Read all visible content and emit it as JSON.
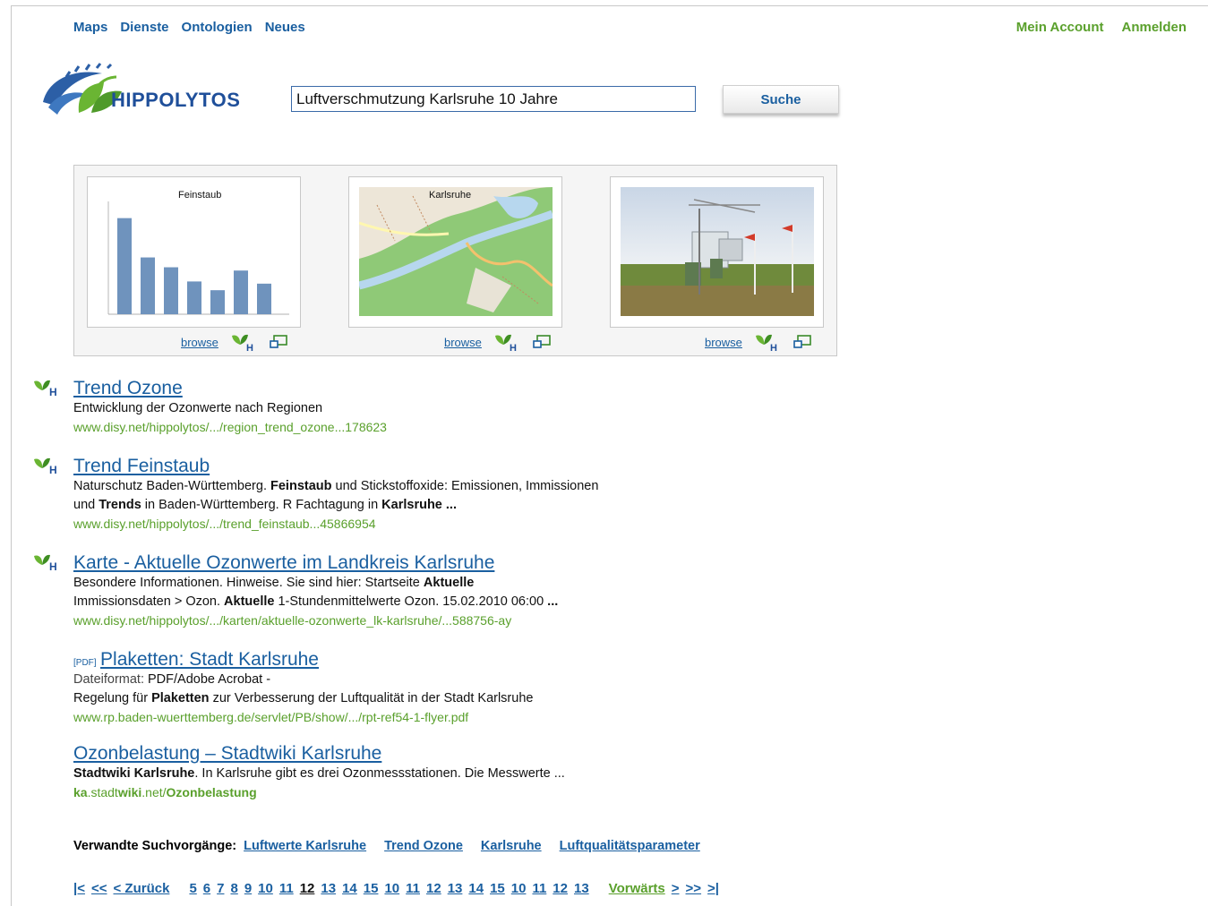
{
  "nav": {
    "items": [
      "Maps",
      "Dienste",
      "Ontologien",
      "Neues"
    ],
    "account": "Mein Account",
    "login": "Anmelden"
  },
  "logo": {
    "text": "HIPPOLYTOS"
  },
  "search": {
    "value": "Luftverschmutzung Karlsruhe 10 Jahre",
    "button": "Suche"
  },
  "previews": [
    {
      "label": "Feinstaub",
      "browse": "browse",
      "type": "chart"
    },
    {
      "label": "Karlsruhe",
      "browse": "browse",
      "type": "map"
    },
    {
      "label": "",
      "browse": "browse",
      "type": "photo"
    }
  ],
  "results": [
    {
      "title": "Trend Ozone",
      "snippet_html": "Entwicklung der Ozonwerte nach Regionen",
      "url": "www.disy.net/hippolytos/.../region_trend_ozone...178623",
      "icon": "hippolytos-icon"
    },
    {
      "title": "Trend Feinstaub",
      "snippet_html": "Naturschutz Baden-Württemberg. <b>Feinstaub</b> und Stickstoffoxide: Emissionen, Immissionen<br>und <b>Trends</b> in Baden-Württemberg. R Fachtagung in <b>Karlsruhe ...</b>",
      "url": "www.disy.net/hippolytos/.../trend_feinstaub...45866954",
      "icon": "hippolytos-icon"
    },
    {
      "title": "Karte - Aktuelle Ozonwerte im Landkreis Karlsruhe",
      "snippet_html": "Besondere Informationen. Hinweise. Sie sind hier: Startseite <b>Aktuelle</b><br>Immissionsdaten &gt; Ozon. <b>Aktuelle</b> 1-Stundenmittelwerte Ozon. 15.02.2010 06:00 <b>...</b>",
      "url": "www.disy.net/hippolytos/.../karten/aktuelle-ozonwerte_lk-karlsruhe/...588756-ay",
      "icon": "hippolytos-icon"
    },
    {
      "title": "Plaketten: Stadt Karlsruhe",
      "pdf": "[PDF]",
      "snippet_html": "<span style='color:#444'>Dateiformat:</span> PDF/Adobe Acrobat -<br>Regelung für <b>Plaketten</b> zur Verbesserung der Luftqualität in der Stadt Karlsruhe",
      "url": "www.rp.baden-wuerttemberg.de/servlet/PB/show/.../rpt-ref54-1-flyer.pdf"
    },
    {
      "title": "Ozonbelastung – Stadtwiki Karlsruhe",
      "snippet_html": "<b>Stadtwiki Karlsruhe</b>. In Karlsruhe gibt es drei Ozonmessstationen. Die Messwerte ...",
      "url_html": "<b>ka</b>.stadt<b>wiki</b>.net/<b>Ozonbelastung</b>"
    }
  ],
  "related": {
    "label": "Verwandte Suchvorgänge:",
    "links": [
      "Luftwerte Karlsruhe",
      "Trend Ozone",
      "Karlsruhe",
      "Luftqualitätsparameter"
    ]
  },
  "pager": {
    "first": "|<",
    "prev2": "<<",
    "prev": "< Zurück",
    "pages": [
      "5",
      "6",
      "7",
      "8",
      "9",
      "10",
      "11",
      "12",
      "13",
      "14",
      "15",
      "10",
      "11",
      "12",
      "13",
      "14",
      "15",
      "10",
      "11",
      "12",
      "13"
    ],
    "current_index": 7,
    "next": "Vorwärts",
    "next1": ">",
    "next2": ">>",
    "last": ">|"
  },
  "chart_values": [
    88,
    52,
    43,
    30,
    22,
    40,
    28
  ],
  "colors": {
    "link_blue": "#1a5fa0",
    "green": "#5aa02c",
    "bar": "#6f93bd"
  }
}
